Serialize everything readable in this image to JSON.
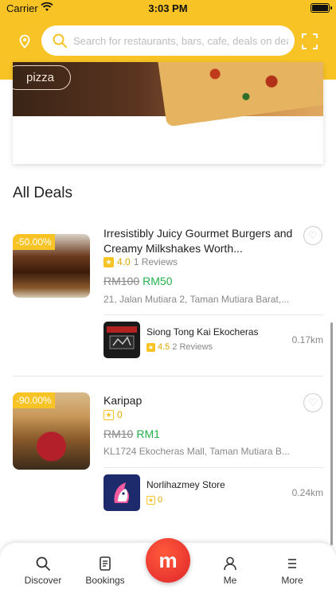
{
  "status_bar": {
    "carrier": "Carrier",
    "time": "3:03 PM"
  },
  "search": {
    "placeholder": "Search for restaurants, bars, cafe, deals on dea"
  },
  "banner": {
    "tag": "pizza"
  },
  "section_title": "All Deals",
  "deals": [
    {
      "badge": "-50.00%",
      "title": "Irresistibly Juicy Gourmet Burgers and Creamy Milkshakes Worth...",
      "rating": "4.0",
      "reviews": "1 Reviews",
      "old_price": "RM100",
      "new_price": "RM50",
      "address": "21, Jalan Mutiara 2, Taman Mutiara Barat,...",
      "store": {
        "name": "Siong Tong Kai Ekocheras",
        "rating": "4.5",
        "reviews": "2 Reviews",
        "distance": "0.17km"
      }
    },
    {
      "badge": "-90.00%",
      "title": "Karipap",
      "rating": "0",
      "reviews": "",
      "old_price": "RM10",
      "new_price": "RM1",
      "address": "KL1724 Ekocheras Mall, Taman Mutiara B...",
      "store": {
        "name": "Norlihazmey Store",
        "rating": "0",
        "reviews": "",
        "distance": "0.24km"
      }
    }
  ],
  "nav": {
    "discover": "Discover",
    "bookings": "Bookings",
    "center": "m",
    "me": "Me",
    "more": "More"
  },
  "colors": {
    "brand_yellow": "#f7c325",
    "price_green": "#22b14c",
    "center_red": "#e0262a"
  }
}
